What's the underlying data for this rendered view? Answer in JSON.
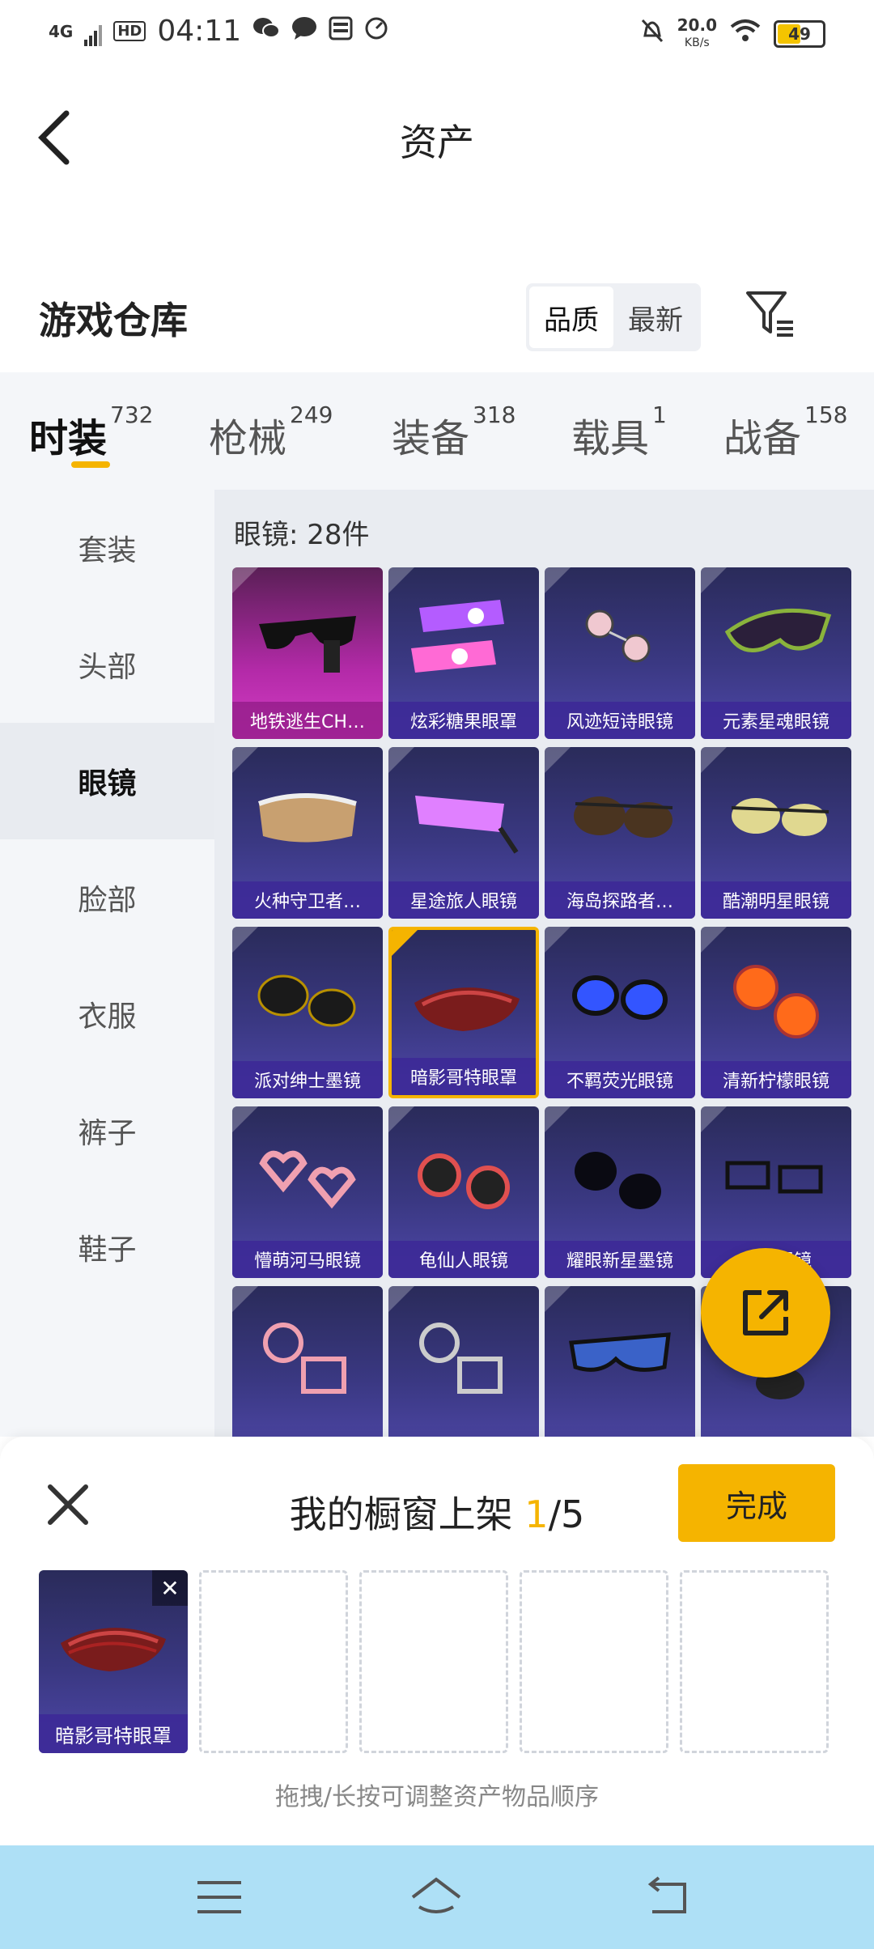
{
  "status_bar": {
    "network": "4G",
    "hd": "HD",
    "time": "04:11",
    "speed_value": "20.0",
    "speed_unit": "KB/s",
    "battery": "49",
    "battery_level": 0.49
  },
  "header": {
    "title": "资产"
  },
  "section": {
    "title": "游戏仓库",
    "sort_options": [
      "品质",
      "最新"
    ],
    "sort_active": "品质"
  },
  "tabs": [
    {
      "label": "时装",
      "count": "732",
      "active": true
    },
    {
      "label": "枪械",
      "count": "249",
      "active": false
    },
    {
      "label": "装备",
      "count": "318",
      "active": false
    },
    {
      "label": "载具",
      "count": "1",
      "active": false
    },
    {
      "label": "战备",
      "count": "158",
      "active": false
    }
  ],
  "sidebar": {
    "items": [
      "套装",
      "头部",
      "眼镜",
      "脸部",
      "衣服",
      "裤子",
      "鞋子"
    ],
    "active": "眼镜"
  },
  "content": {
    "count_label": "眼镜: 28件",
    "items": [
      {
        "name": "地铁逃生CH…",
        "style": "pink",
        "selected": false
      },
      {
        "name": "炫彩糖果眼罩",
        "style": "purple",
        "selected": false
      },
      {
        "name": "风迹短诗眼镜",
        "style": "purple",
        "selected": false
      },
      {
        "name": "元素星魂眼镜",
        "style": "purple",
        "selected": false
      },
      {
        "name": "火种守卫者…",
        "style": "purple",
        "selected": false
      },
      {
        "name": "星途旅人眼镜",
        "style": "purple",
        "selected": false
      },
      {
        "name": "海岛探路者…",
        "style": "purple",
        "selected": false
      },
      {
        "name": "酷潮明星眼镜",
        "style": "purple",
        "selected": false
      },
      {
        "name": "派对绅士墨镜",
        "style": "purple",
        "selected": false
      },
      {
        "name": "暗影哥特眼罩",
        "style": "purple",
        "selected": true
      },
      {
        "name": "不羁荧光眼镜",
        "style": "purple",
        "selected": false
      },
      {
        "name": "清新柠檬眼镜",
        "style": "purple",
        "selected": false
      },
      {
        "name": "懵萌河马眼镜",
        "style": "purple",
        "selected": false
      },
      {
        "name": "龟仙人眼镜",
        "style": "purple",
        "selected": false
      },
      {
        "name": "耀眼新星墨镜",
        "style": "purple",
        "selected": false
      },
      {
        "name": "魔…眼镜",
        "style": "purple",
        "selected": false
      },
      {
        "name": "",
        "style": "purple",
        "selected": false
      },
      {
        "name": "",
        "style": "purple",
        "selected": false
      },
      {
        "name": "",
        "style": "purple",
        "selected": false
      },
      {
        "name": "",
        "style": "purple",
        "selected": false
      }
    ]
  },
  "panel": {
    "title_prefix": "我的橱窗上架 ",
    "title_current": "1",
    "title_suffix": "/5",
    "done_label": "完成",
    "slot_item": "暗影哥特眼罩",
    "remove_icon": "✕",
    "hint": "拖拽/长按可调整资产物品顺序"
  },
  "colors": {
    "accent": "#f5b400",
    "card_purple": "#3a3882",
    "card_pink": "#b32aa8",
    "nav_bg": "#aee0f6"
  }
}
